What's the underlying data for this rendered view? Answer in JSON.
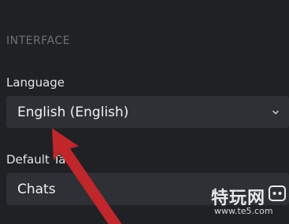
{
  "section": {
    "title": "INTERFACE"
  },
  "language": {
    "label": "Language",
    "value": "English (English)"
  },
  "default_tab": {
    "label": "Default Tab",
    "value": "Chats"
  },
  "watermark": {
    "text": "特玩网",
    "url": "www.te5.com"
  },
  "colors": {
    "background": "#1f2124",
    "select_bg": "#2d3034",
    "arrow": "#c0262a"
  },
  "icons": {
    "dropdown": "chevron-down-icon",
    "annotation": "red-arrow"
  }
}
